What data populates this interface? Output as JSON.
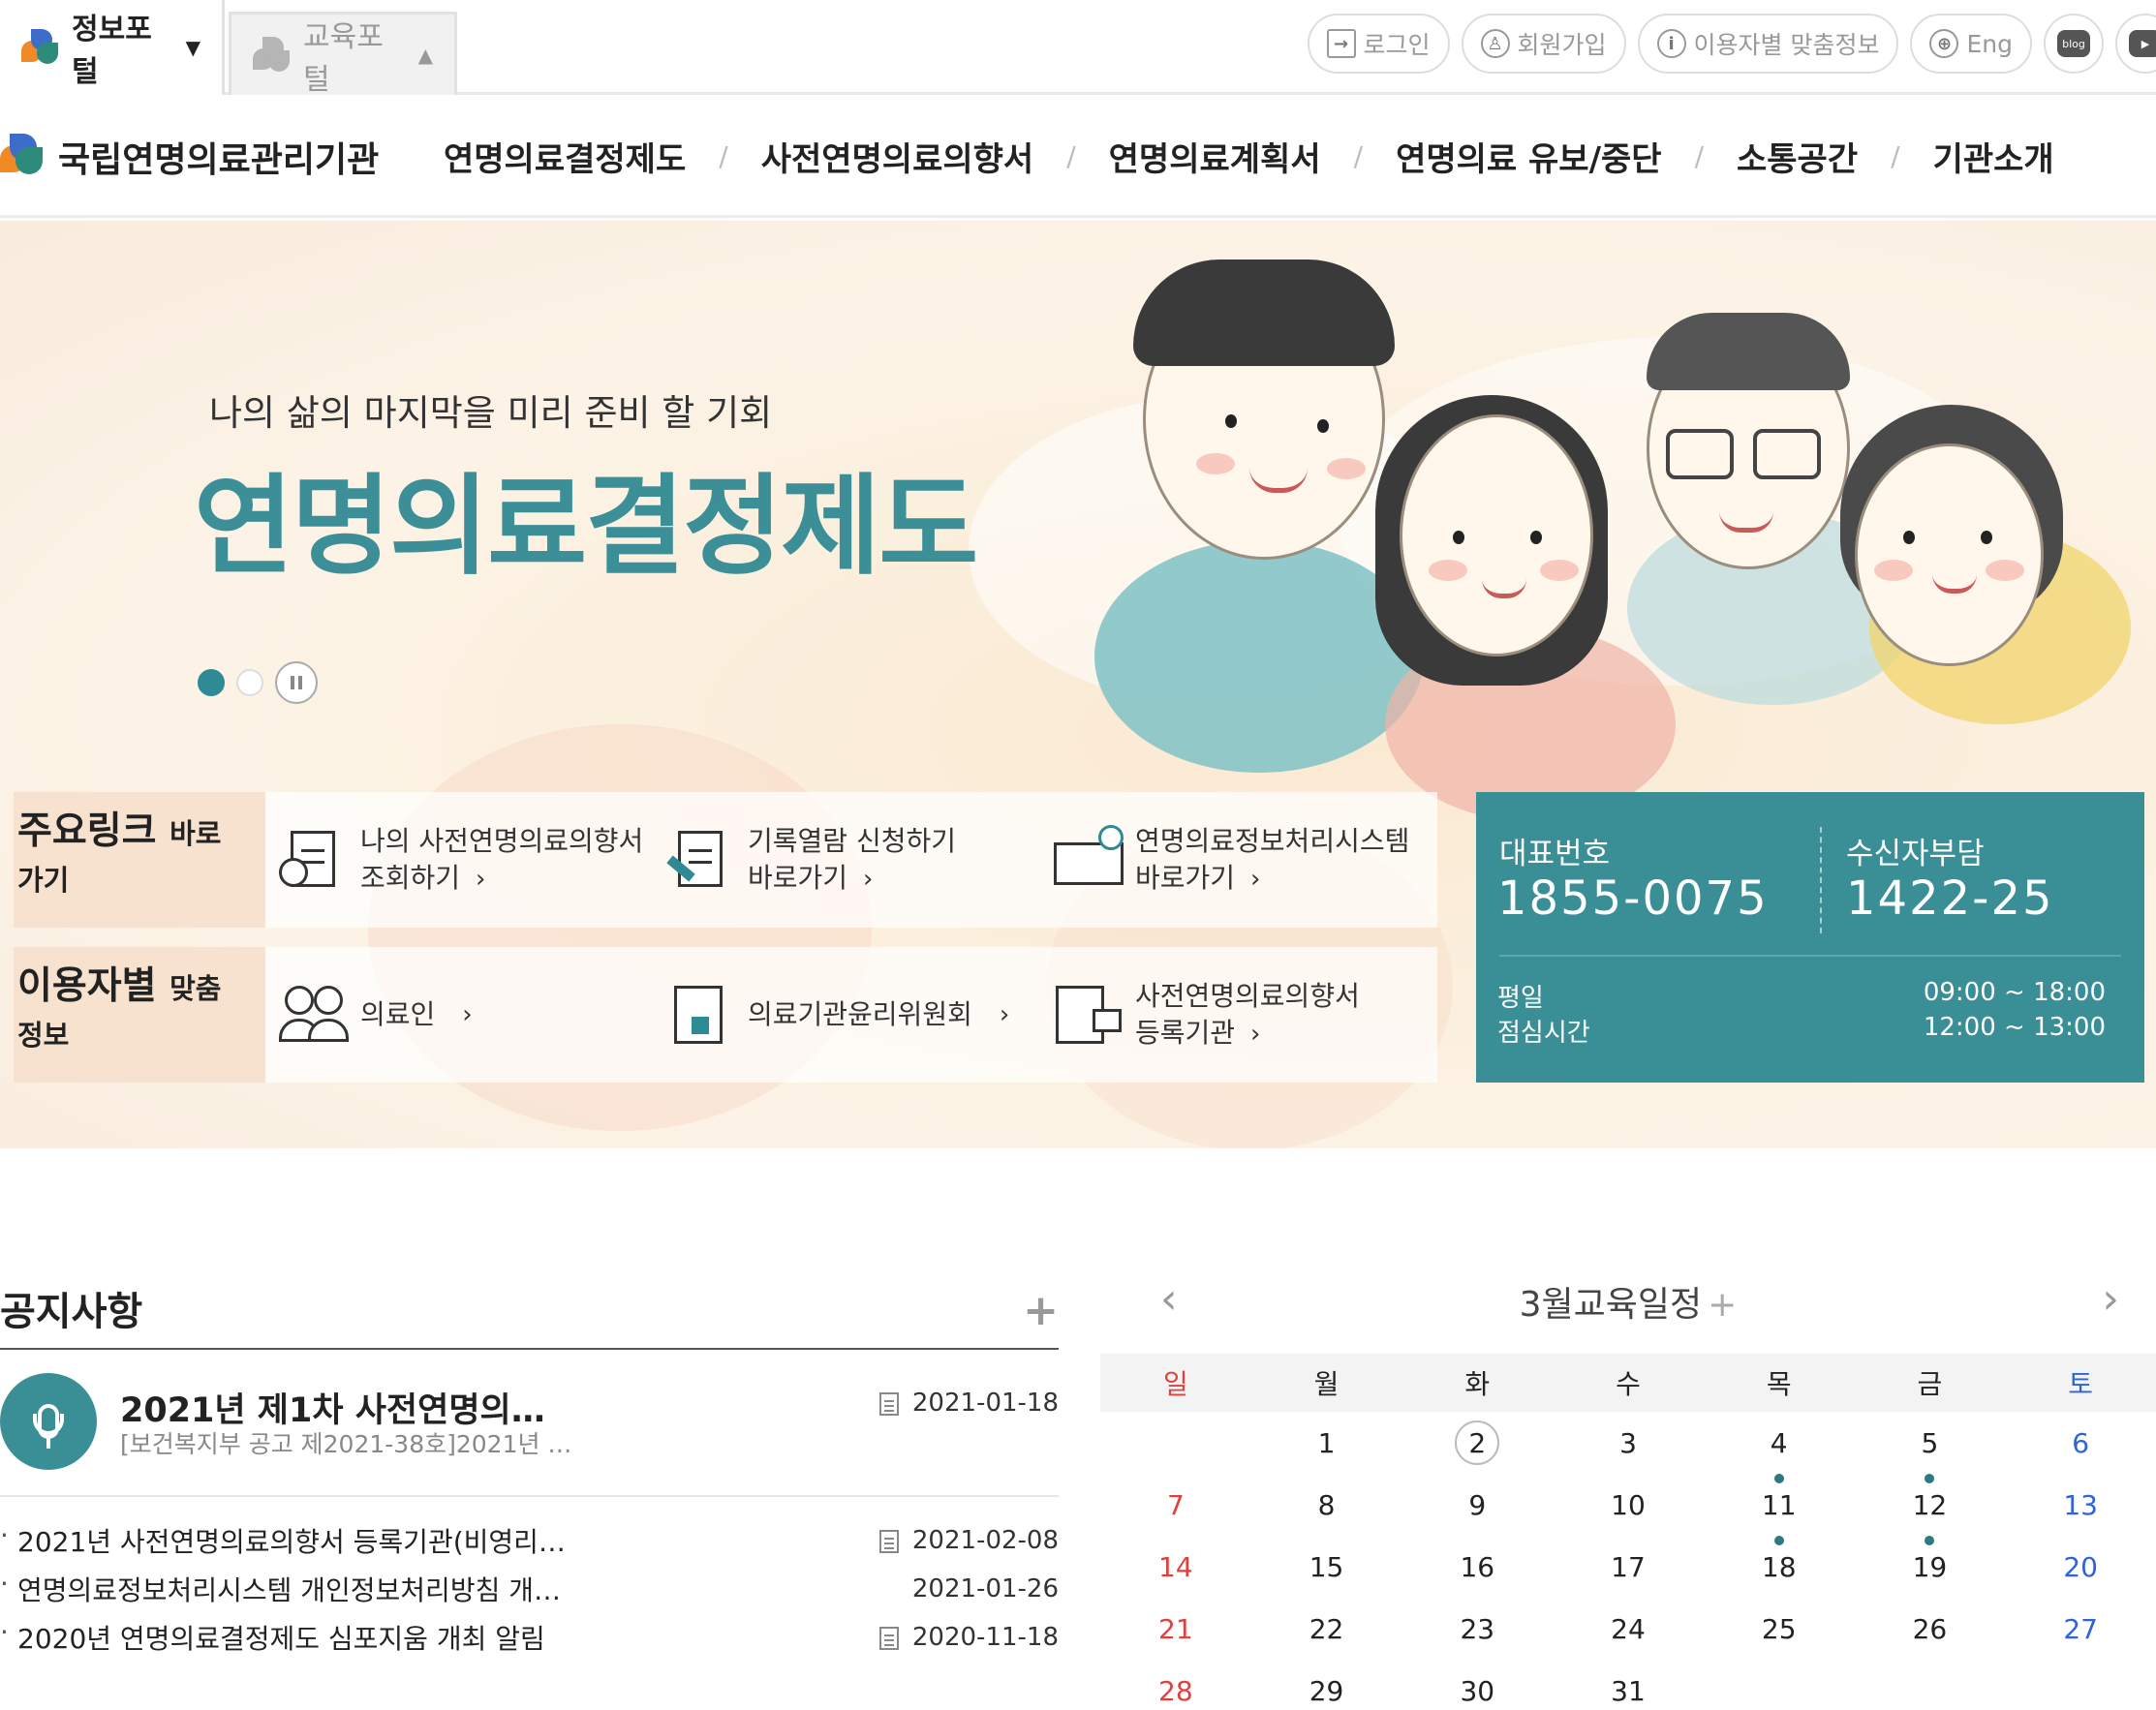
{
  "portal_tabs": [
    {
      "label": "정보포털",
      "caret": "▼",
      "active": true
    },
    {
      "label": "교육포털",
      "caret": "▲",
      "active": false
    }
  ],
  "util_buttons": [
    {
      "label": "로그인",
      "icon": "login-icon"
    },
    {
      "label": "회원가입",
      "icon": "user-icon"
    },
    {
      "label": "이용자별 맞춤정보",
      "icon": "info-icon"
    },
    {
      "label": "Eng",
      "icon": "globe-icon"
    },
    {
      "label": "blog",
      "icon": "blog-icon"
    },
    {
      "label": "",
      "icon": "youtube-icon"
    }
  ],
  "brand": {
    "name": "국립연명의료관리기관"
  },
  "gnb": [
    "연명의료결정제도",
    "사전연명의료의향서",
    "연명의료계획서",
    "연명의료 유보/중단",
    "소통공간",
    "기관소개"
  ],
  "gnb_separator": "/",
  "hero": {
    "subtitle": "나의 삶의 마지막을 미리 준비 할 기회",
    "title": "연명의료결정제도",
    "slides": 2,
    "active_slide": 1
  },
  "quick_links": {
    "row1": {
      "label_big": "주요링크",
      "label_small": "바로",
      "label_line2": "가기",
      "links": [
        {
          "line1": "나의 사전연명의료의향서",
          "line2": "조회하기",
          "icon": "search-document-icon"
        },
        {
          "line1": "기록열람 신청하기",
          "line2": "바로가기",
          "icon": "edit-document-icon"
        },
        {
          "line1": "연명의료정보처리시스템",
          "line2": "바로가기",
          "icon": "system-chart-icon"
        }
      ]
    },
    "row2": {
      "label_big": "이용자별",
      "label_small": "맞춤",
      "label_line2": "정보",
      "links": [
        {
          "line1": "의료인",
          "line2": "",
          "icon": "medical-staff-icon"
        },
        {
          "line1": "의료기관윤리위원회",
          "line2": "",
          "icon": "hospital-icon"
        },
        {
          "line1": "사전연명의료의향서",
          "line2": "등록기관",
          "icon": "building-icon"
        }
      ]
    },
    "chevron": "›"
  },
  "contact": {
    "main_label": "대표번호",
    "main_number": "1855-0075",
    "collect_label": "수신자부담",
    "collect_number": "1422-25",
    "weekday_label": "평일",
    "weekday_hours": "09:00 ~ 18:00",
    "lunch_label": "점심시간",
    "lunch_hours": "12:00 ~ 13:00"
  },
  "notices": {
    "title": "공지사항",
    "more": "+",
    "featured": {
      "title": "2021년 제1차 사전연명의…",
      "summary": "[보건복지부 공고 제2021-38호]2021년 …",
      "date": "2021-01-18"
    },
    "items": [
      {
        "title": "2021년 사전연명의료의향서 등록기관(비영리…",
        "date": "2021-02-08",
        "has_attachment": true
      },
      {
        "title": "연명의료정보처리시스템 개인정보처리방침 개…",
        "date": "2021-01-26",
        "has_attachment": false
      },
      {
        "title": "2020년 연명의료결정제도 심포지움 개최 알림",
        "date": "2020-11-18",
        "has_attachment": true
      }
    ]
  },
  "calendar": {
    "title": "3월교육일정",
    "plus": "+",
    "prev": "‹",
    "next": "›",
    "weekdays": [
      "일",
      "월",
      "화",
      "수",
      "목",
      "금",
      "토"
    ],
    "start_offset": 1,
    "days_in_view": 31,
    "today": 2,
    "event_days": [
      11,
      12,
      18,
      19
    ],
    "colors": {
      "sunday": "#e0413e",
      "saturday": "#2f64d6",
      "accent": "#3a8f96"
    }
  }
}
